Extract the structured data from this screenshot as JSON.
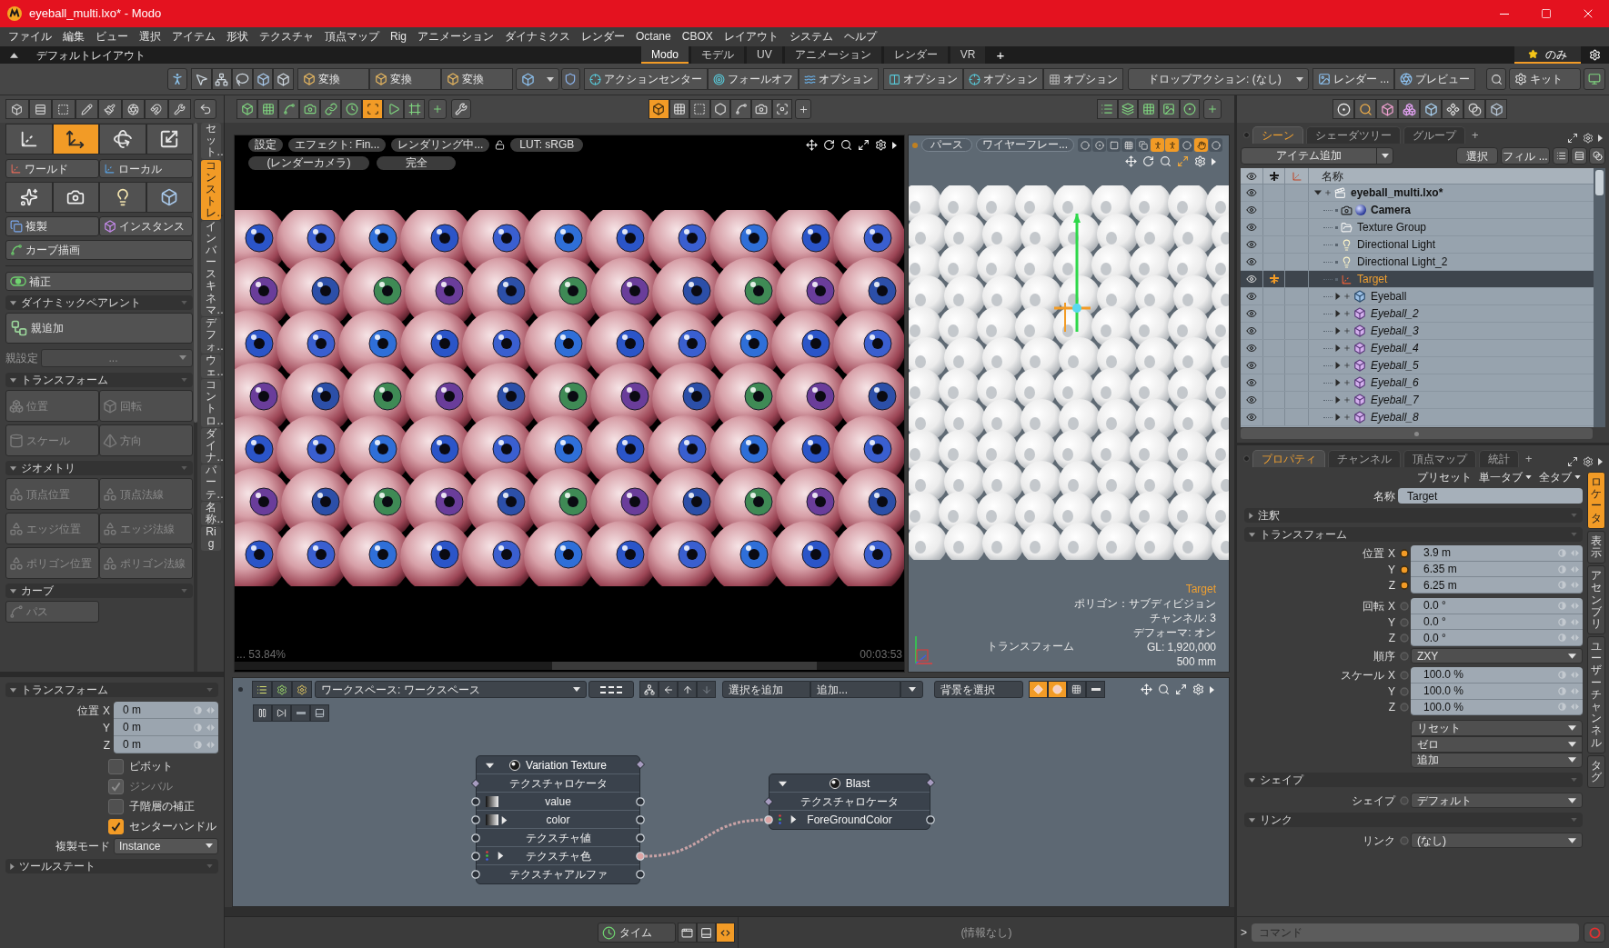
{
  "window": {
    "title": "eyeball_multi.lxo* - Modo"
  },
  "menu_bar": [
    "ファイル",
    "編集",
    "ビュー",
    "選択",
    "アイテム",
    "形状",
    "テクスチャ",
    "頂点マップ",
    "Rig",
    "アニメーション",
    "ダイナミクス",
    "レンダー",
    "Octane",
    "CBOX",
    "レイアウト",
    "システム",
    "ヘルプ"
  ],
  "layout_bar": {
    "layout_name": "デフォルトレイアウト",
    "tabs": [
      {
        "label": "Modo",
        "selected": true
      },
      {
        "label": "モデル",
        "selected": false
      },
      {
        "label": "UV",
        "selected": false
      },
      {
        "label": "アニメーション",
        "selected": false
      },
      {
        "label": "レンダー",
        "selected": false
      },
      {
        "label": "VR",
        "selected": false
      }
    ],
    "add_tab": "+",
    "favorites": {
      "label": "のみ",
      "selected": true
    }
  },
  "main_toolbar": {
    "transform_buttons": [
      "変換",
      "変換",
      "変換"
    ],
    "action_center": "アクションセンター",
    "falloff": "フォールオフ",
    "options": [
      "オプション",
      "オプション",
      "オプション",
      "オプション"
    ],
    "drop_action": "ドロップアクション: (なし)",
    "render": "レンダー ...",
    "preview": "プレビュー",
    "kit": "キット"
  },
  "secondary_toolbar": {
    "model_tools": [
      {
        "selected": false
      },
      {
        "selected": false
      },
      {
        "selected": false
      },
      {
        "selected": false
      },
      {
        "selected": false
      },
      {
        "selected": false
      },
      {
        "selected": true
      },
      {
        "selected": false
      },
      {
        "selected": false
      }
    ],
    "view_tools": [
      {
        "selected": true
      },
      {
        "selected": false
      },
      {
        "selected": false
      },
      {
        "selected": false
      },
      {
        "selected": false
      },
      {
        "selected": false
      },
      {
        "selected": false
      }
    ]
  },
  "tool_panel": {
    "tool_buttons": [
      {
        "selected": false
      },
      {
        "selected": true
      },
      {
        "selected": false
      },
      {
        "selected": false
      }
    ],
    "space_buttons": [
      "ワールド",
      "ローカル"
    ],
    "duplicate_buttons": [
      "複製",
      "インスタンス"
    ],
    "curve_button": "カーブ描画",
    "correction": {
      "label": "補正",
      "on": true
    },
    "dynamic_parent": {
      "title": "ダイナミックペアレント",
      "expanded": true,
      "add_parent": "親追加",
      "parent_label": "親設定",
      "parent_value": "..."
    },
    "sections": [
      {
        "title": "トランスフォーム",
        "expanded": true,
        "buttons": [
          {
            "label": "位置",
            "disabled": true
          },
          {
            "label": "回転",
            "disabled": true
          },
          {
            "label": "スケール",
            "disabled": true
          },
          {
            "label": "方向",
            "disabled": true
          }
        ]
      },
      {
        "title": "ジオメトリ",
        "expanded": true,
        "buttons": [
          {
            "label": "頂点位置",
            "disabled": true
          },
          {
            "label": "頂点法線",
            "disabled": true
          },
          {
            "label": "エッジ位置",
            "disabled": true
          },
          {
            "label": "エッジ法線",
            "disabled": true
          },
          {
            "label": "ポリゴン位置",
            "disabled": true
          },
          {
            "label": "ポリゴン法線",
            "disabled": true
          }
        ]
      },
      {
        "title": "カーブ",
        "expanded": true,
        "buttons": [
          {
            "label": "パス",
            "disabled": true
          }
        ]
      }
    ],
    "side_tabs": [
      {
        "label": "セット…",
        "selected": false
      },
      {
        "label": "コンストレ…",
        "selected": true
      },
      {
        "label": "インバースキネマ…",
        "selected": false
      },
      {
        "label": "デフォ…",
        "selected": false
      },
      {
        "label": "ウェ…",
        "selected": false
      },
      {
        "label": "コントロ…",
        "selected": false
      },
      {
        "label": "ダイナ…",
        "selected": false
      },
      {
        "label": "パーテ…",
        "selected": false
      },
      {
        "label": "名称…",
        "selected": false
      },
      {
        "label": "Rig",
        "selected": false
      }
    ],
    "tool_properties": {
      "title": "トランスフォーム",
      "expanded": true,
      "position_label": "位置",
      "position": [
        {
          "axis": "X",
          "value": "0 m"
        },
        {
          "axis": "Y",
          "value": "0 m"
        },
        {
          "axis": "Z",
          "value": "0 m"
        }
      ],
      "options": [
        {
          "label": "ピボット",
          "checked": false,
          "disabled": false
        },
        {
          "label": "ジンバル",
          "checked": true,
          "disabled": true
        },
        {
          "label": "子階層の補正",
          "checked": false,
          "disabled": false
        },
        {
          "label": "センターハンドル",
          "checked": true,
          "disabled": false
        }
      ],
      "duplicate_mode_label": "複製モード",
      "duplicate_mode": "Instance",
      "tool_state": {
        "title": "ツールステート",
        "expanded": false
      }
    }
  },
  "render_view": {
    "buttons": [
      "設定",
      "エフェクト: Fin...",
      "レンダリング中..."
    ],
    "lut": "LUT: sRGB",
    "camera": "(レンダーカメラ)",
    "quality": "完全",
    "progress": "... 53.84%",
    "elapsed": "00:03:53"
  },
  "viewport_3d": {
    "projection": "パース",
    "shading": "ワイヤーフレー...",
    "display_toggles": [
      {
        "selected": false
      },
      {
        "selected": false
      },
      {
        "selected": false
      },
      {
        "selected": false
      },
      {
        "selected": false
      },
      {
        "selected": true
      },
      {
        "selected": true
      },
      {
        "selected": false
      },
      {
        "selected": true
      },
      {
        "selected": false
      }
    ],
    "info": {
      "item": "Target",
      "lines": [
        "ポリゴン：サブディビジョン",
        "チャンネル: 3",
        "デフォーマ: オン",
        "GL: 1,920,000",
        "500 mm"
      ]
    },
    "tool_label": "トランスフォーム"
  },
  "node_editor": {
    "workspace": "ワークスペース: ワークスペース",
    "add_selection": "選択を追加",
    "add_menu": "追加...",
    "select_background": "背景を選択",
    "display_toggles": [
      {
        "selected": true
      },
      {
        "selected": true
      },
      {
        "selected": false
      },
      {
        "selected": false
      }
    ],
    "nodes": [
      {
        "title": "Variation Texture",
        "expanded": true,
        "ports": [
          {
            "label": "テクスチャロケータ",
            "kind": "locator",
            "input_connected": false
          },
          {
            "label": "value",
            "kind": "value_ramp",
            "input_connected": false,
            "output_connected": false
          },
          {
            "label": "color",
            "kind": "color_ramp",
            "input_connected": false,
            "output_connected": false
          },
          {
            "label": "テクスチャ値",
            "kind": "plain",
            "input_connected": false,
            "output_connected": false
          },
          {
            "label": "テクスチャ色",
            "kind": "color",
            "input_connected": false,
            "output_connected": true
          },
          {
            "label": "テクスチャアルファ",
            "kind": "plain",
            "input_connected": false,
            "output_connected": false
          }
        ]
      },
      {
        "title": "Blast",
        "expanded": true,
        "ports": [
          {
            "label": "テクスチャロケータ",
            "kind": "locator",
            "input_connected": false
          },
          {
            "label": "ForeGroundColor",
            "kind": "color",
            "input_connected": true,
            "output_connected": false
          }
        ]
      }
    ]
  },
  "status_bar": {
    "time_button": "タイム",
    "view_toggles": [
      {
        "selected": false
      },
      {
        "selected": false
      },
      {
        "selected": true
      }
    ],
    "info": "(情報なし)"
  },
  "scene_panel": {
    "tabs": [
      {
        "label": "シーン",
        "selected": true
      },
      {
        "label": "シェーダツリー",
        "selected": false
      },
      {
        "label": "グループ",
        "selected": false
      }
    ],
    "add_tab": "+",
    "add_item": "アイテム追加",
    "select_button": "選択",
    "filter_button": "フィル ...",
    "name_column": "名称",
    "tree": [
      {
        "name": "eyeball_multi.lxo*",
        "kind": "scene",
        "expanded": true,
        "bold": true,
        "selected": false,
        "visible": true,
        "column_2_marked": false,
        "children": [
          {
            "name": "Camera",
            "kind": "camera",
            "bold": true,
            "selected": false,
            "visible": true,
            "column_2_marked": false
          },
          {
            "name": "Texture Group",
            "kind": "folder",
            "bold": false,
            "selected": false,
            "visible": true,
            "column_2_marked": false
          },
          {
            "name": "Directional Light",
            "kind": "light",
            "bold": false,
            "selected": false,
            "visible": true,
            "column_2_marked": false
          },
          {
            "name": "Directional Light_2",
            "kind": "light",
            "bold": false,
            "selected": false,
            "visible": true,
            "column_2_marked": false
          },
          {
            "name": "Target",
            "kind": "locator",
            "bold": false,
            "selected": true,
            "visible": true,
            "column_2_marked": true
          },
          {
            "name": "Eyeball",
            "kind": "mesh",
            "expanded": false,
            "bold": false,
            "selected": false,
            "visible": true,
            "column_2_marked": false
          },
          {
            "name": "Eyeball_2",
            "kind": "instance",
            "expanded": false,
            "bold": false,
            "selected": false,
            "visible": true,
            "column_2_marked": false
          },
          {
            "name": "Eyeball_3",
            "kind": "instance",
            "expanded": false,
            "bold": false,
            "selected": false,
            "visible": true,
            "column_2_marked": false
          },
          {
            "name": "Eyeball_4",
            "kind": "instance",
            "expanded": false,
            "bold": false,
            "selected": false,
            "visible": true,
            "column_2_marked": false
          },
          {
            "name": "Eyeball_5",
            "kind": "instance",
            "expanded": false,
            "bold": false,
            "selected": false,
            "visible": true,
            "column_2_marked": false
          },
          {
            "name": "Eyeball_6",
            "kind": "instance",
            "expanded": false,
            "bold": false,
            "selected": false,
            "visible": true,
            "column_2_marked": false
          },
          {
            "name": "Eyeball_7",
            "kind": "instance",
            "expanded": false,
            "bold": false,
            "selected": false,
            "visible": true,
            "column_2_marked": false
          },
          {
            "name": "Eyeball_8",
            "kind": "instance",
            "expanded": false,
            "bold": false,
            "selected": false,
            "visible": true,
            "column_2_marked": false
          }
        ]
      }
    ]
  },
  "properties_panel": {
    "tabs": [
      {
        "label": "プロパティ",
        "selected": true
      },
      {
        "label": "チャンネル",
        "selected": false
      },
      {
        "label": "頂点マップ",
        "selected": false
      },
      {
        "label": "統計",
        "selected": false
      }
    ],
    "add_tab": "+",
    "presets": "プリセット",
    "tab_modes": [
      "単一タブ",
      "全タブ"
    ],
    "side_tabs": [
      {
        "label": "ロケータ",
        "selected": true
      },
      {
        "label": "表示",
        "selected": false
      },
      {
        "label": "アセンブリ",
        "selected": false
      },
      {
        "label": "ユーザーチャンネル",
        "selected": false
      },
      {
        "label": "タグ",
        "selected": false
      }
    ],
    "name_label": "名称",
    "name_value": "Target",
    "sections": [
      {
        "title": "注釈",
        "expanded": false
      },
      {
        "title": "トランスフォーム",
        "expanded": true,
        "rows": [
          {
            "kind": "vector",
            "label": "位置",
            "channels": [
              {
                "axis": "X",
                "value": "3.9 m",
                "keyed": true
              },
              {
                "axis": "Y",
                "value": "6.35 m",
                "keyed": true
              },
              {
                "axis": "Z",
                "value": "6.25 m",
                "keyed": true
              }
            ]
          },
          {
            "kind": "vector",
            "label": "回転",
            "channels": [
              {
                "axis": "X",
                "value": "0.0 °",
                "keyed": false
              },
              {
                "axis": "Y",
                "value": "0.0 °",
                "keyed": false
              },
              {
                "axis": "Z",
                "value": "0.0 °",
                "keyed": false
              }
            ]
          },
          {
            "kind": "dropdown",
            "label": "順序",
            "value": "ZXY"
          },
          {
            "kind": "vector",
            "label": "スケール",
            "channels": [
              {
                "axis": "X",
                "value": "100.0 %",
                "keyed": false
              },
              {
                "axis": "Y",
                "value": "100.0 %",
                "keyed": false
              },
              {
                "axis": "Z",
                "value": "100.0 %",
                "keyed": false
              }
            ]
          },
          {
            "kind": "menus",
            "items": [
              "リセット",
              "ゼロ",
              "追加"
            ]
          }
        ]
      },
      {
        "title": "シェイプ",
        "expanded": true,
        "rows": [
          {
            "kind": "dropdown",
            "label": "シェイプ",
            "value": "デフォルト"
          }
        ]
      },
      {
        "title": "リンク",
        "expanded": true,
        "rows": [
          {
            "kind": "dropdown",
            "label": "リンク",
            "value": "(なし)"
          }
        ]
      }
    ]
  },
  "command_bar": {
    "prompt": ">",
    "placeholder": "コマンド"
  }
}
